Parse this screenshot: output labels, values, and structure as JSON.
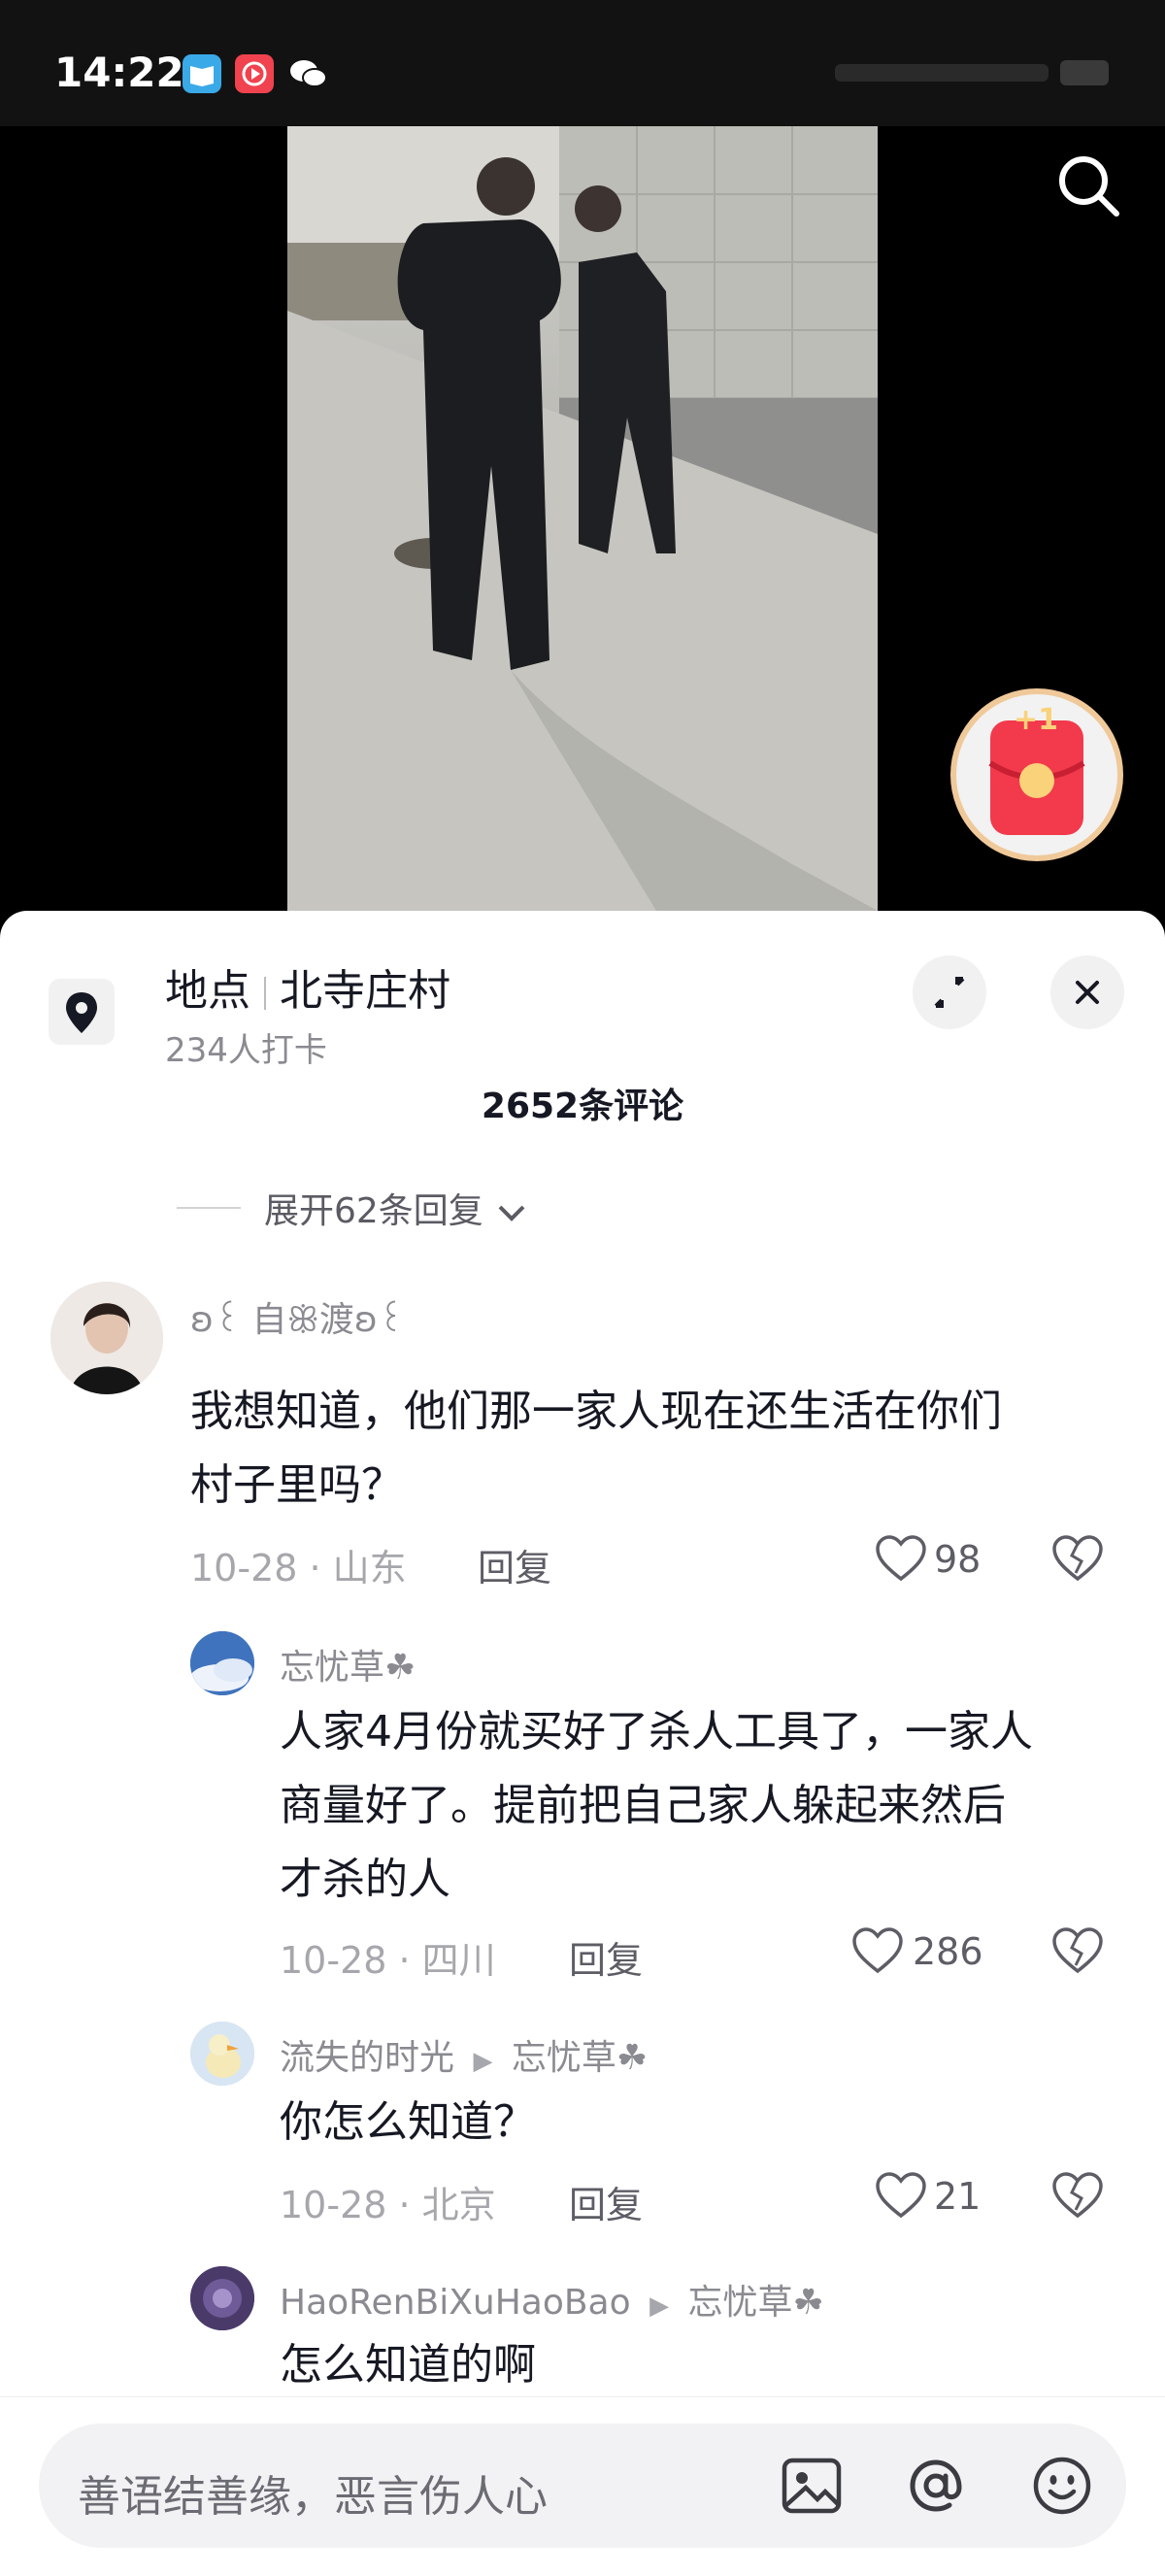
{
  "status_bar": {
    "time": "14:22"
  },
  "location": {
    "prefix": "地点",
    "name": "北寺庄村",
    "checkins": "234人打卡"
  },
  "comments_header": {
    "count": "2652条评论",
    "expand_replies": "展开62条回复"
  },
  "comments": [
    {
      "user": "ʚ꒰ 自ꕥ渡ʚ꒰",
      "text_line1": "我想知道，他们那一家人现在还生活在你们",
      "text_line2": "村子里吗？",
      "meta": "10-28 · 山东",
      "reply": "回复",
      "likes": "98"
    },
    {
      "user": "忘忧草☘",
      "text_line1": "人家4月份就买好了杀人工具了，一家人",
      "text_line2": "商量好了。提前把自己家人躲起来然后",
      "text_line3": "才杀的人",
      "meta": "10-28 · 四川",
      "reply": "回复",
      "likes": "286"
    },
    {
      "user": "流失的时光",
      "reply_to": "忘忧草☘",
      "text_line1": "你怎么知道？",
      "meta": "10-28 · 北京",
      "reply": "回复",
      "likes": "21"
    },
    {
      "user": "HaoRenBiXuHaoBao",
      "reply_to": "忘忧草☘",
      "text_line1": "怎么知道的啊"
    }
  ],
  "input": {
    "placeholder": "善语结善缘，恶言伤人心"
  },
  "redpacket": {
    "badge": "+1"
  },
  "colors": {
    "sheet_bg": "#ffffff",
    "text": "#161823",
    "muted": "#8a8b91",
    "redpacket": "#f23a4c"
  }
}
